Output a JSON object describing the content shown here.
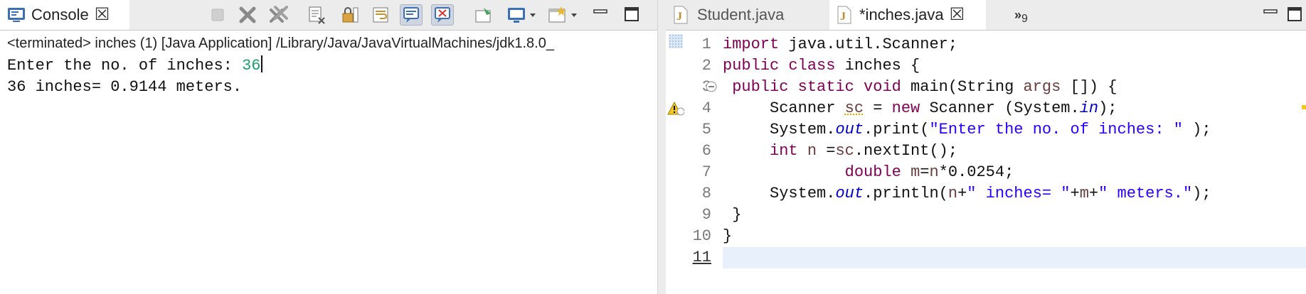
{
  "console_view": {
    "tab_label": "Console",
    "header": "<terminated> inches (1) [Java Application] /Library/Java/JavaVirtualMachines/jdk1.8.0_",
    "output_prompt": "Enter the no. of inches: ",
    "output_input": "36",
    "output_result": "36 inches= 0.9144 meters.",
    "toolbar_icons": [
      "terminate-icon",
      "remove-launch-icon",
      "remove-all-launches-icon",
      "clear-console-icon",
      "scroll-lock-icon",
      "word-wrap-icon",
      "show-on-stdout-icon",
      "show-on-stderr-icon",
      "pin-console-icon",
      "display-console-icon",
      "open-console-icon",
      "minimize-icon",
      "maximize-icon"
    ]
  },
  "editor": {
    "tabs": [
      {
        "label": "Student.java",
        "active": false
      },
      {
        "label": "*inches.java",
        "active": true
      }
    ],
    "overflow_count": "9",
    "line_numbers": [
      "1",
      "2",
      "3",
      "4",
      "5",
      "6",
      "7",
      "8",
      "9",
      "10",
      "11"
    ]
  },
  "colors": {
    "keyword": "#7f0055",
    "string": "#2a00ff",
    "static_field": "#0000c0",
    "console_input": "#21a06c"
  }
}
